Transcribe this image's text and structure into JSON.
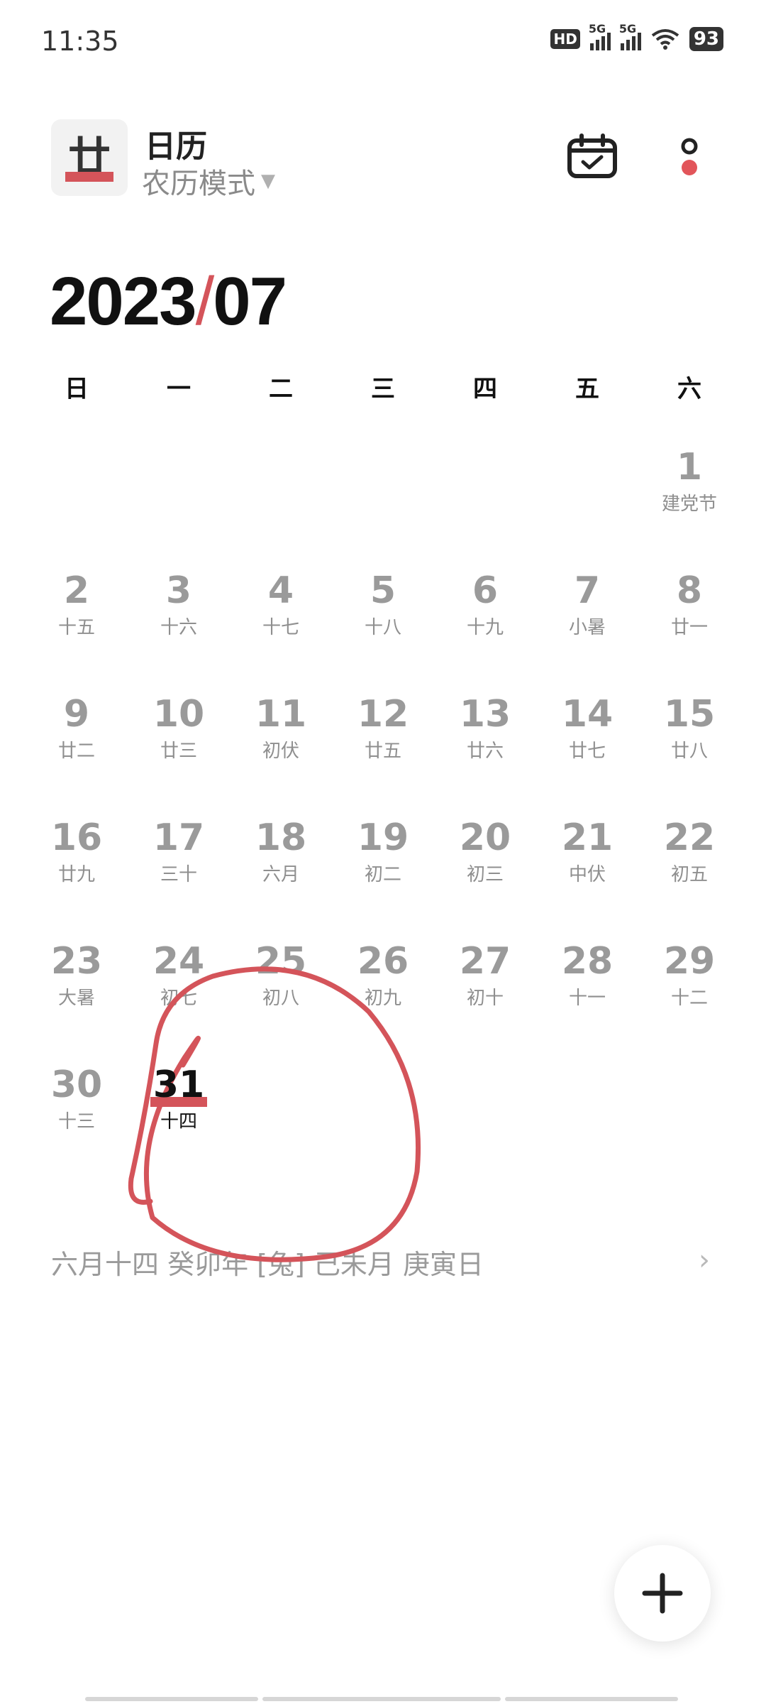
{
  "status": {
    "time": "11:35",
    "hd": "HD",
    "sim1": "5G",
    "sim2": "5G",
    "battery": "93"
  },
  "header": {
    "logo_glyph": "廿",
    "title": "日历",
    "mode": "农历模式"
  },
  "month": {
    "year": "2023",
    "separator": "/",
    "month": "07"
  },
  "weekdays": [
    "日",
    "一",
    "二",
    "三",
    "四",
    "五",
    "六"
  ],
  "weeks": [
    [
      {
        "n": "",
        "s": ""
      },
      {
        "n": "",
        "s": ""
      },
      {
        "n": "",
        "s": ""
      },
      {
        "n": "",
        "s": ""
      },
      {
        "n": "",
        "s": ""
      },
      {
        "n": "",
        "s": ""
      },
      {
        "n": "1",
        "s": "建党节"
      }
    ],
    [
      {
        "n": "2",
        "s": "十五"
      },
      {
        "n": "3",
        "s": "十六"
      },
      {
        "n": "4",
        "s": "十七"
      },
      {
        "n": "5",
        "s": "十八"
      },
      {
        "n": "6",
        "s": "十九"
      },
      {
        "n": "7",
        "s": "小暑"
      },
      {
        "n": "8",
        "s": "廿一"
      }
    ],
    [
      {
        "n": "9",
        "s": "廿二"
      },
      {
        "n": "10",
        "s": "廿三"
      },
      {
        "n": "11",
        "s": "初伏"
      },
      {
        "n": "12",
        "s": "廿五"
      },
      {
        "n": "13",
        "s": "廿六"
      },
      {
        "n": "14",
        "s": "廿七"
      },
      {
        "n": "15",
        "s": "廿八"
      }
    ],
    [
      {
        "n": "16",
        "s": "廿九"
      },
      {
        "n": "17",
        "s": "三十"
      },
      {
        "n": "18",
        "s": "六月"
      },
      {
        "n": "19",
        "s": "初二"
      },
      {
        "n": "20",
        "s": "初三"
      },
      {
        "n": "21",
        "s": "中伏"
      },
      {
        "n": "22",
        "s": "初五"
      }
    ],
    [
      {
        "n": "23",
        "s": "大暑"
      },
      {
        "n": "24",
        "s": "初七"
      },
      {
        "n": "25",
        "s": "初八"
      },
      {
        "n": "26",
        "s": "初九"
      },
      {
        "n": "27",
        "s": "初十"
      },
      {
        "n": "28",
        "s": "十一"
      },
      {
        "n": "29",
        "s": "十二"
      }
    ],
    [
      {
        "n": "30",
        "s": "十三"
      },
      {
        "n": "31",
        "s": "十四",
        "today": true
      }
    ]
  ],
  "lunar_info": "六月十四  癸卯年 [兔] 己未月 庚寅日",
  "colors": {
    "accent": "#d4545a",
    "muted_text": "#9a9a9a"
  },
  "icons": {
    "calendar": "calendar-check-icon",
    "more": "more-icon",
    "add": "plus-icon",
    "chevron": "chevron-right-icon"
  }
}
